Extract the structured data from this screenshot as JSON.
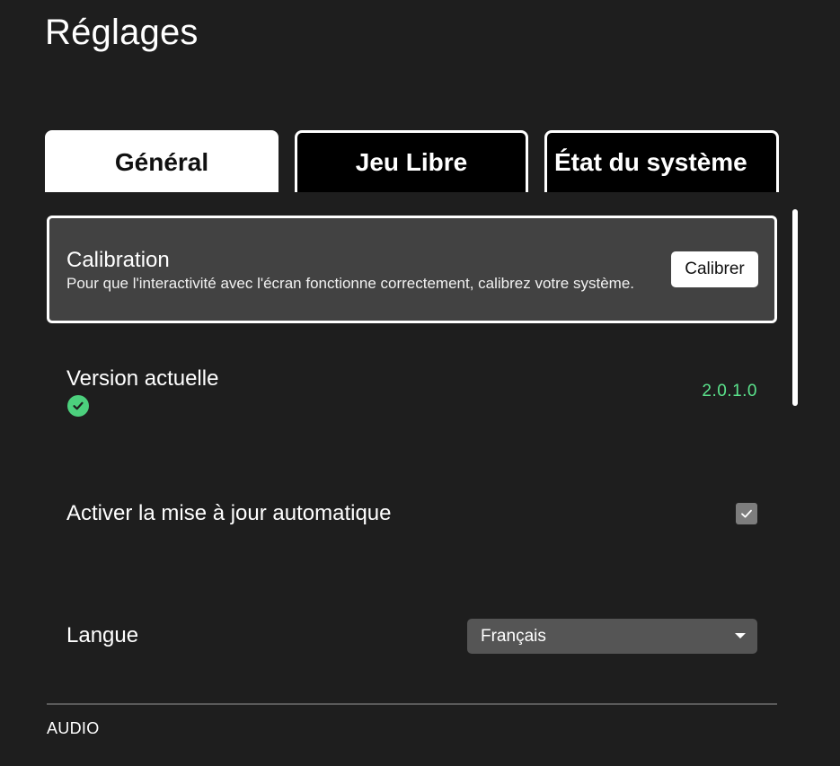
{
  "page": {
    "title": "Réglages"
  },
  "tabs": [
    {
      "label": "Général",
      "active": true
    },
    {
      "label": "Jeu Libre",
      "active": false
    },
    {
      "label": "État du système",
      "active": false
    }
  ],
  "calibration": {
    "title": "Calibration",
    "description": "Pour que l'interactivité avec l'écran fonctionne correctement, calibrez votre système.",
    "button_label": "Calibrer"
  },
  "version": {
    "label": "Version actuelle",
    "value": "2.0.1.0",
    "status_icon": "check-circle-icon",
    "status_color": "#4cd07d"
  },
  "auto_update": {
    "label": "Activer la mise à jour automatique",
    "checked": true
  },
  "language": {
    "label": "Langue",
    "selected": "Français"
  },
  "sections": {
    "audio_header": "AUDIO"
  },
  "colors": {
    "background": "#1e1e1e",
    "card": "#424242",
    "accent_green": "#5be38c"
  }
}
